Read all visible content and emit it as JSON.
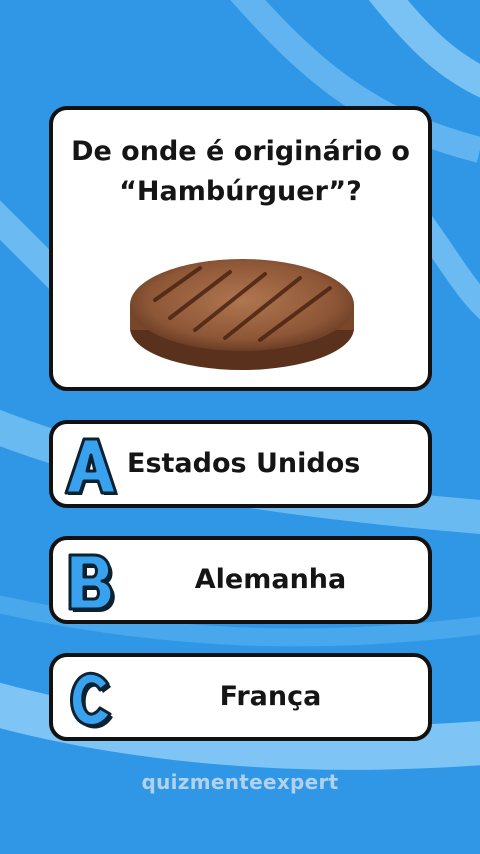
{
  "quiz": {
    "question": "De onde é originário o “Hambúrguer”?",
    "image_icon": "hamburger-patty-icon",
    "answers": [
      {
        "letter": "A",
        "text": "Estados Unidos"
      },
      {
        "letter": "B",
        "text": "Alemanha"
      },
      {
        "letter": "C",
        "text": "França"
      }
    ]
  },
  "watermark": "quizmenteexpert",
  "colors": {
    "background": "#2f97e6",
    "stripe": "#7fc6f6",
    "letter_fill": "#39a2ee",
    "letter_outline": "#0b2233"
  }
}
